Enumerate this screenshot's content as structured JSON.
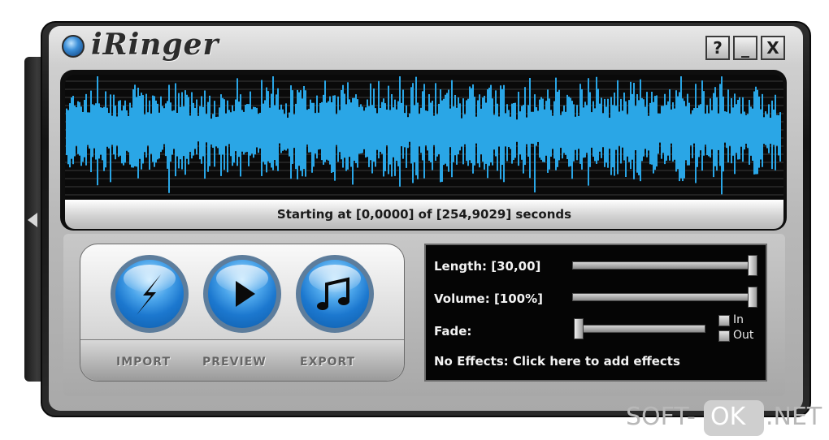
{
  "app": {
    "title": "iRinger"
  },
  "window_controls": {
    "help": "?",
    "minimize": "_",
    "close": "X"
  },
  "waveform": {
    "status_text": "Starting at [0,0000] of [254,9029] seconds",
    "color": "#2aa6e6"
  },
  "actions": [
    {
      "label": "IMPORT",
      "icon": "lightning-icon"
    },
    {
      "label": "PREVIEW",
      "icon": "play-icon"
    },
    {
      "label": "EXPORT",
      "icon": "music-note-icon"
    }
  ],
  "settings": {
    "length": {
      "label": "Length: [30,00]",
      "value_fraction": 1.0
    },
    "volume": {
      "label": "Volume: [100%]",
      "value_fraction": 1.0
    },
    "fade": {
      "label": "Fade:",
      "value_fraction": 0.0,
      "in_label": "In",
      "out_label": "Out"
    },
    "effects_text": "No Effects: Click here to add effects"
  },
  "watermark": {
    "left": "SOFT-",
    "mid": "OK",
    "right": ".NET"
  }
}
